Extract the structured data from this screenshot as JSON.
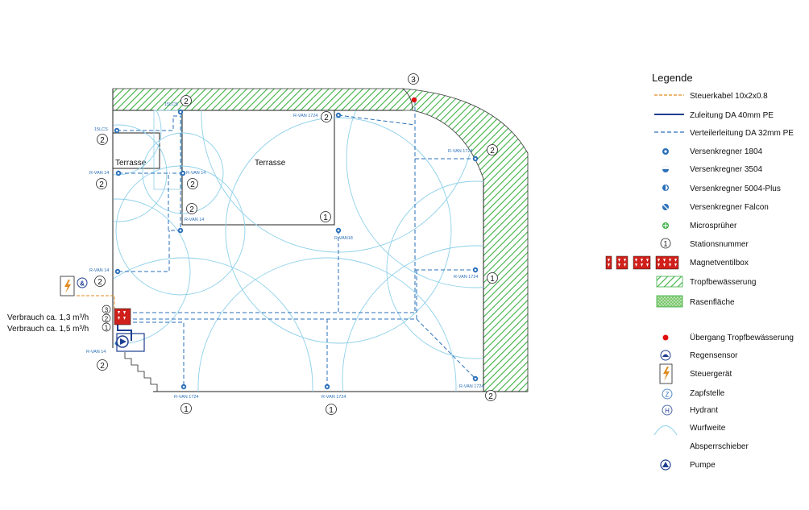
{
  "labels": {
    "terrace_small": "Terrasse",
    "terrace_large": "Terrasse",
    "consumption_1": "Verbrauch ca. 1,3 m³/h",
    "consumption_2": "Verbrauch ca. 1,5 m³/h"
  },
  "sprinkler_labels": {
    "s_15lcs_top": "15LCS",
    "s_15lcs_left": "15LCS",
    "s_rvan14_a": "R-VAN 14",
    "s_rvan14_b": "R-VAN 14",
    "s_rvan14_c": "R-VAN 14",
    "s_rvan14_d": "R-VAN 14",
    "s_rvan14_e": "R-VAN 14",
    "s_rvan18": "R-VAN18",
    "s_rvan1724_a": "R-VAN 1724",
    "s_rvan1724_b": "R-VAN 1724",
    "s_rvan1724_c": "R-VAN 1724",
    "s_rvan1724_d": "R-VAN 1724",
    "s_rvan1724_e": "R-VAN 1724",
    "s_rvan1724_f": "R-VAN 1724"
  },
  "station_numbers": {
    "n1": "1",
    "n2": "1",
    "n3": "1",
    "n4": "1",
    "n5": "2",
    "n6": "2",
    "n7": "2",
    "n8": "2",
    "n9": "2",
    "n10": "2",
    "n11": "2",
    "n12": "2",
    "n13": "2",
    "n14": "2",
    "n15": "2",
    "n16": "3",
    "v1": "3",
    "v2": "2",
    "v3": "1"
  },
  "legend": {
    "title": "Legende",
    "items": [
      {
        "key": "control_cable",
        "label": "Steuerkabel 10x2x0.8"
      },
      {
        "key": "supply_line",
        "label": "Zuleitung  DA 40mm  PE"
      },
      {
        "key": "distribution_line",
        "label": "Verteilerleitung  DA 32mm  PE"
      },
      {
        "key": "sprinkler_1804",
        "label": "Versenkregner 1804"
      },
      {
        "key": "sprinkler_3504",
        "label": "Versenkregner 3504"
      },
      {
        "key": "sprinkler_5004",
        "label": "Versenkregner 5004-Plus"
      },
      {
        "key": "sprinkler_falcon",
        "label": "Versenkregner Falcon"
      },
      {
        "key": "micro_sprayer",
        "label": "Microsprüher"
      },
      {
        "key": "station_number",
        "label": "Stationsnummer",
        "symbol": "1"
      },
      {
        "key": "valve_box",
        "label": "Magnetventilbox"
      },
      {
        "key": "drip_irrigation",
        "label": "Tropfbewässerung"
      },
      {
        "key": "lawn_area",
        "label": "Rasenfläche"
      },
      {
        "key": "drip_transition",
        "label": "Übergang Tropfbewässerung"
      },
      {
        "key": "rain_sensor",
        "label": "Regensensor"
      },
      {
        "key": "controller",
        "label": "Steuergerät"
      },
      {
        "key": "tap",
        "label": "Zapfstelle",
        "symbol": "Z"
      },
      {
        "key": "hydrant",
        "label": "Hydrant",
        "symbol": "H"
      },
      {
        "key": "throw_range",
        "label": "Wurfweite"
      },
      {
        "key": "shutoff_valve",
        "label": "Absperrschieber"
      },
      {
        "key": "pump",
        "label": "Pumpe"
      }
    ]
  },
  "colors": {
    "pipe_blue": "#2a6fb8",
    "supply_navy": "#1f3f8f",
    "cable_orange": "#e08a1e",
    "arc_light_blue": "#8ed0ea",
    "drip_green": "#3cb043",
    "valve_red": "#d0201b",
    "transition_red": "#e01010"
  }
}
